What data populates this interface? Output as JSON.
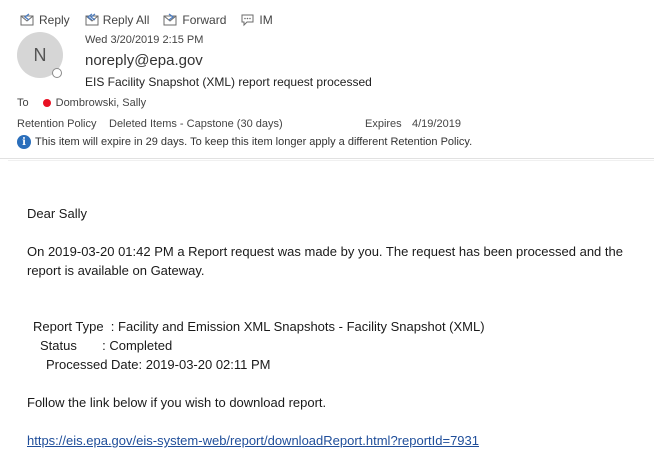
{
  "toolbar": {
    "reply": "Reply",
    "reply_all": "Reply All",
    "forward": "Forward",
    "im": "IM"
  },
  "message": {
    "avatar_initial": "N",
    "date": "Wed 3/20/2019 2:15 PM",
    "from": "noreply@epa.gov",
    "subject": "EIS Facility Snapshot (XML) report request processed",
    "to_label": "To",
    "recipient": "Dombrowski, Sally",
    "retention_label": "Retention Policy",
    "retention_value": "Deleted Items - Capstone (30 days)",
    "expires_label": "Expires",
    "expires_value": "4/19/2019",
    "info_text": "This item will expire in 29 days. To keep this item longer apply a different Retention Policy."
  },
  "body": {
    "greeting": "Dear Sally",
    "para1_line1": "On 2019-03-20 01:42 PM a Report request was made by you. The request has been processed and the",
    "para1_line2": "report is available on Gateway.",
    "report_type": "Report Type  : Facility and Emission XML Snapshots - Facility Snapshot (XML)",
    "status": "Status       : Completed",
    "processed_date": "Processed Date: 2019-03-20 02:11 PM",
    "follow": "Follow the link below if you wish to download report.",
    "link": "https://eis.epa.gov/eis-system-web/report/downloadReport.html?reportId=7931"
  },
  "colors": {
    "presence_busy": "#e81123",
    "info_blue": "#2a6ebb",
    "link": "#1f4e9a"
  }
}
